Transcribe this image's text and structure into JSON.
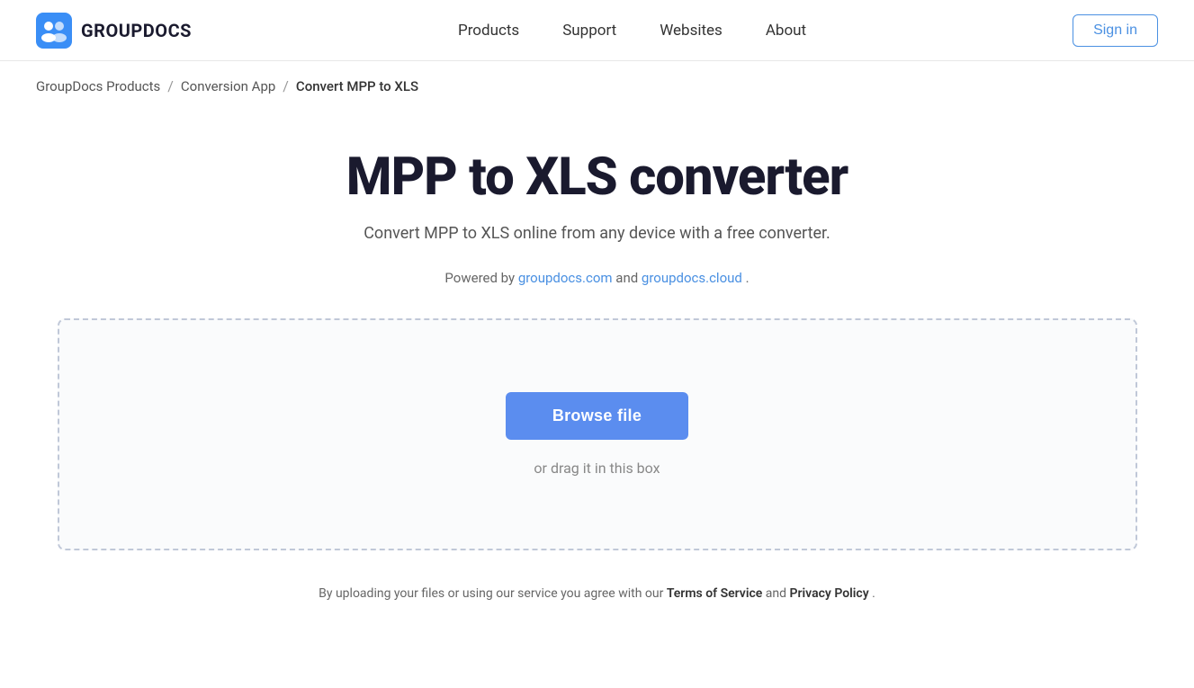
{
  "header": {
    "logo_text": "GROUPDOCS",
    "nav": {
      "items": [
        {
          "label": "Products",
          "id": "products"
        },
        {
          "label": "Support",
          "id": "support"
        },
        {
          "label": "Websites",
          "id": "websites"
        },
        {
          "label": "About",
          "id": "about"
        }
      ],
      "sign_in": "Sign in"
    }
  },
  "breadcrumb": {
    "items": [
      {
        "label": "GroupDocs Products",
        "id": "groupdocs-products"
      },
      {
        "label": "Conversion App",
        "id": "conversion-app"
      },
      {
        "label": "Convert MPP to XLS",
        "id": "convert-mpp-xls"
      }
    ]
  },
  "main": {
    "title": "MPP to XLS converter",
    "subtitle": "Convert MPP to XLS online from any device with a free converter.",
    "powered_by_text": "Powered by ",
    "powered_by_link1": "groupdocs.com",
    "powered_by_and": " and ",
    "powered_by_link2": "groupdocs.cloud",
    "powered_by_end": ".",
    "browse_button": "Browse file",
    "drag_hint": "or drag it in this box"
  },
  "footer": {
    "prefix": "By uploading your files or using our service you agree with our ",
    "tos": "Terms of Service",
    "and": " and ",
    "privacy": "Privacy Policy",
    "suffix": "."
  },
  "colors": {
    "accent": "#5b8def",
    "link": "#4a90e2",
    "border": "#c0c8d8"
  }
}
